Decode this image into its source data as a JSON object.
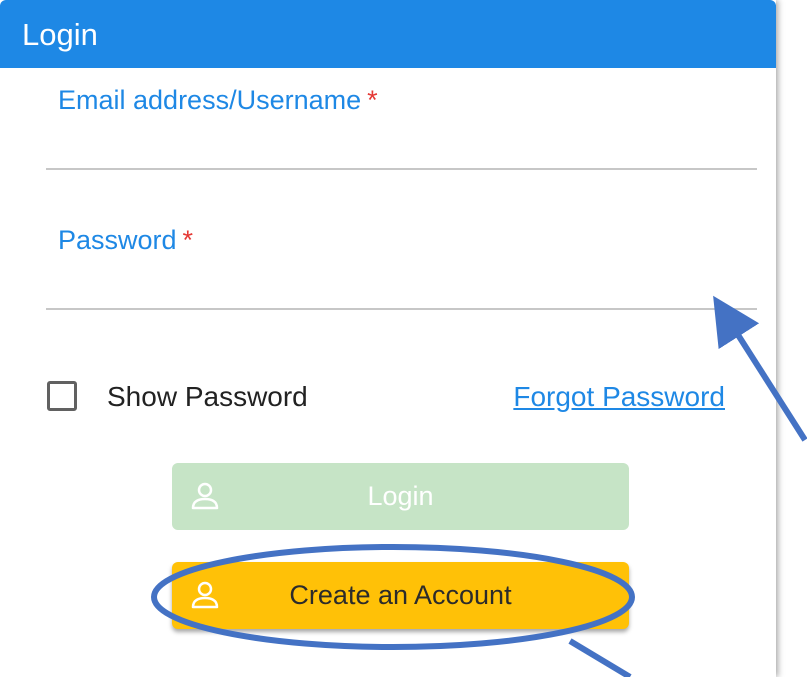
{
  "header": {
    "title": "Login"
  },
  "email_field": {
    "label": "Email address/Username",
    "required_mark": "*",
    "value": ""
  },
  "password_field": {
    "label": "Password",
    "required_mark": "*",
    "value": ""
  },
  "show_password": {
    "label": "Show Password",
    "checked": false
  },
  "forgot_password": {
    "label": "Forgot Password"
  },
  "buttons": {
    "login": {
      "label": "Login",
      "icon": "user-icon"
    },
    "create_account": {
      "label": "Create an Account",
      "icon": "user-icon"
    }
  },
  "colors": {
    "primary": "#1e88e5",
    "required": "#e53935",
    "login_button_disabled": "#c6e4c6",
    "create_button": "#ffc107",
    "annotation": "#4472c4"
  }
}
